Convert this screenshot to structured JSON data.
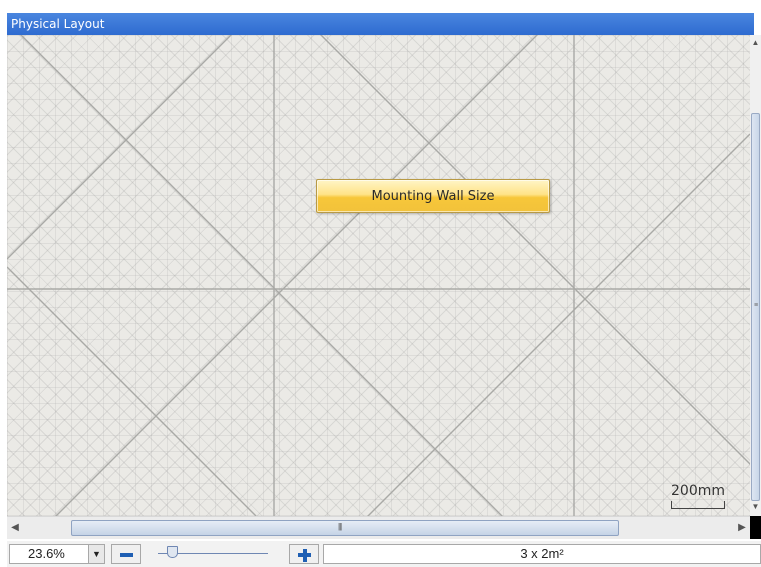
{
  "window": {
    "title": "Physical Layout"
  },
  "canvas": {
    "action_button_label": "Mounting Wall Size",
    "scale_label": "200mm"
  },
  "status": {
    "zoom": "23.6%",
    "wall_size": "3 x 2m²"
  },
  "icons": {
    "zoom_dropdown": "chevron-down-icon",
    "zoom_out": "minus-icon",
    "zoom_in": "plus-icon"
  },
  "colors": {
    "titlebar": "#2e6bd0",
    "button_gold": "#f7c73a",
    "zoom_icon_blue": "#1f5fb3"
  }
}
